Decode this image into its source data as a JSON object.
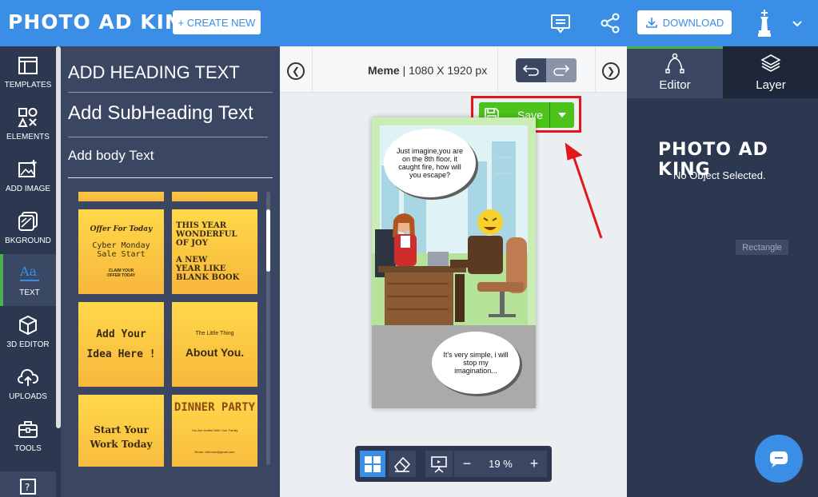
{
  "header": {
    "logo": "PHOTO AD KING",
    "create_new": "+ CREATE NEW",
    "download": "DOWNLOAD",
    "accent": "#3a8ee6"
  },
  "leftnav": {
    "items": [
      {
        "label": "TEMPLATES",
        "icon": "templates-icon"
      },
      {
        "label": "ELEMENTS",
        "icon": "elements-icon"
      },
      {
        "label": "ADD IMAGE",
        "icon": "add-image-icon"
      },
      {
        "label": "BKGROUND",
        "icon": "background-icon"
      },
      {
        "label": "TEXT",
        "icon": "text-icon"
      },
      {
        "label": "3D EDITOR",
        "icon": "3d-editor-icon"
      },
      {
        "label": "UPLOADS",
        "icon": "uploads-icon"
      },
      {
        "label": "TOOLS",
        "icon": "tools-icon"
      }
    ],
    "active": "TEXT"
  },
  "text_panel": {
    "heading": "ADD HEADING TEXT",
    "subheading": "Add SubHeading Text",
    "body": "Add body Text",
    "tiles": [
      {
        "lines": [
          "Offer For Today",
          "Cyber Monday",
          "Sale Start",
          "CLAIM YOUR",
          "OFFER TODAY"
        ]
      },
      {
        "lines": [
          "THIS YEAR",
          "WONDERFUL",
          "OF JOY",
          "A NEW",
          "YEAR LIKE",
          "BLANK BOOK"
        ]
      },
      {
        "lines": [
          "Add Your",
          "Idea Here !"
        ]
      },
      {
        "lines": [
          "The Little Thing",
          "About You."
        ]
      },
      {
        "lines": [
          "Start Your",
          "Work Today"
        ]
      },
      {
        "lines": [
          "DINNER PARTY",
          "You Are Invited With Your Family",
          "Email: Johndoe@gmail.com"
        ]
      }
    ]
  },
  "canvas": {
    "doc_type": "Meme",
    "dimensions": "1080 X 1920 px",
    "save_label": "Save",
    "bubble_top": "Just imagine,you are on the 8th floor, it caught fire, how will you escape?",
    "bubble_bottom": "It's very simple, i will stop my imagination..."
  },
  "zoom": {
    "value": "19 %",
    "minus": "−",
    "plus": "+"
  },
  "right_panel": {
    "tabs": [
      {
        "label": "Editor",
        "icon": "editor-icon"
      },
      {
        "label": "Layer",
        "icon": "layer-icon"
      }
    ],
    "logo": "PHOTO AD KING",
    "message": "No Object Selected.",
    "rectangle_label": "Rectangle"
  }
}
